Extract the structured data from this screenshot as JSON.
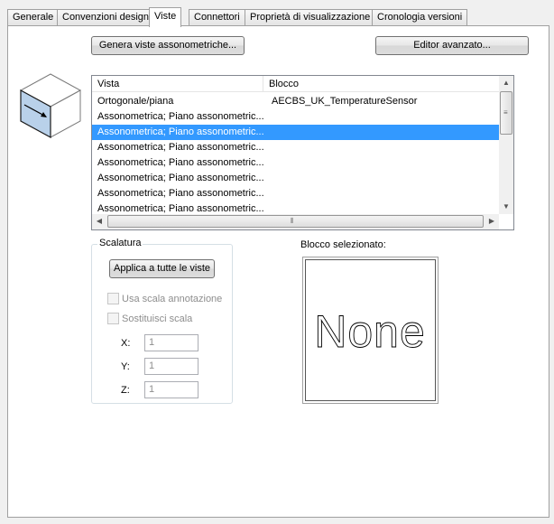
{
  "tabs": [
    {
      "label": "Generale",
      "active": false
    },
    {
      "label": "Convenzioni design",
      "active": false
    },
    {
      "label": "Viste",
      "active": true
    },
    {
      "label": "Connettori",
      "active": false
    },
    {
      "label": "Proprietà di visualizzazione",
      "active": false
    },
    {
      "label": "Cronologia versioni",
      "active": false
    }
  ],
  "buttons": {
    "generate_iso": "Genera viste assonometriche...",
    "advanced_editor": "Editor avanzato...",
    "apply_all": "Applica a tutte le viste"
  },
  "list": {
    "headers": {
      "view": "Vista",
      "block": "Blocco"
    },
    "rows": [
      {
        "view": "Ortogonale/piana",
        "block": "AECBS_UK_TemperatureSensor",
        "selected": false
      },
      {
        "view": "Assonometrica; Piano assonometric...",
        "block": "",
        "selected": false
      },
      {
        "view": "Assonometrica; Piano assonometric...",
        "block": "",
        "selected": true
      },
      {
        "view": "Assonometrica; Piano assonometric...",
        "block": "",
        "selected": false
      },
      {
        "view": "Assonometrica; Piano assonometric...",
        "block": "",
        "selected": false
      },
      {
        "view": "Assonometrica; Piano assonometric...",
        "block": "",
        "selected": false
      },
      {
        "view": "Assonometrica; Piano assonometric...",
        "block": "",
        "selected": false
      },
      {
        "view": "Assonometrica; Piano assonometric...",
        "block": "",
        "selected": false
      }
    ]
  },
  "scaling": {
    "legend": "Scalatura",
    "use_annotation_scale": "Usa scala annotazione",
    "override_scale": "Sostituisci scala",
    "x_label": "X:",
    "x_value": "1",
    "y_label": "Y:",
    "y_value": "1",
    "z_label": "Z:",
    "z_value": "1"
  },
  "selected_block": {
    "label": "Blocco selezionato:",
    "preview_text": "None"
  },
  "colors": {
    "selection": "#3399ff",
    "cube_front": "#b9d1ea"
  }
}
